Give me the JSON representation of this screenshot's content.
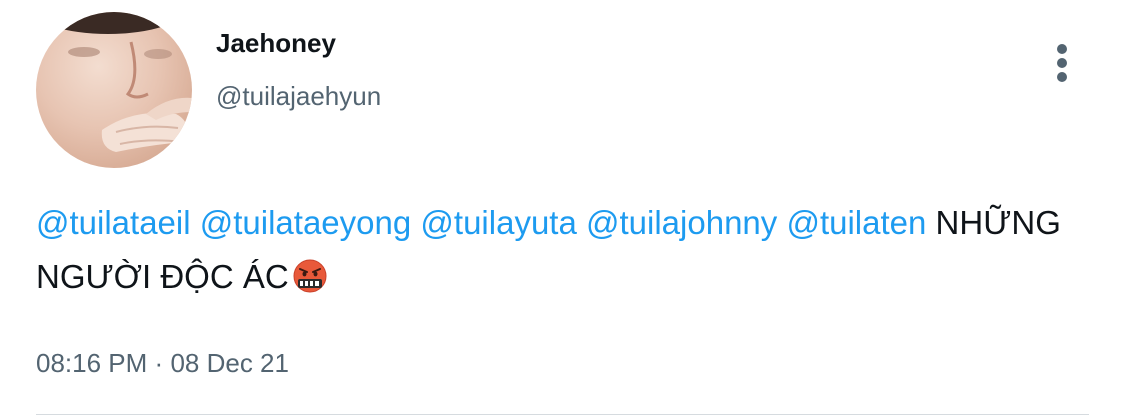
{
  "tweet": {
    "display_name": "Jaehoney",
    "handle": "@tuilajaehyun",
    "mentions": [
      "@tuilataeil",
      "@tuilataeyong",
      "@tuilayuta",
      "@tuilajohnny",
      "@tuilaten"
    ],
    "text": "NHỮNG NGƯỜI ĐỘC ÁC",
    "emoji": "face-with-symbols-over-mouth",
    "time": "08:16 PM",
    "separator": "·",
    "date": "08 Dec 21"
  },
  "colors": {
    "mention": "#1d9bf0",
    "secondary_text": "#536471",
    "primary_text": "#0f1419"
  }
}
